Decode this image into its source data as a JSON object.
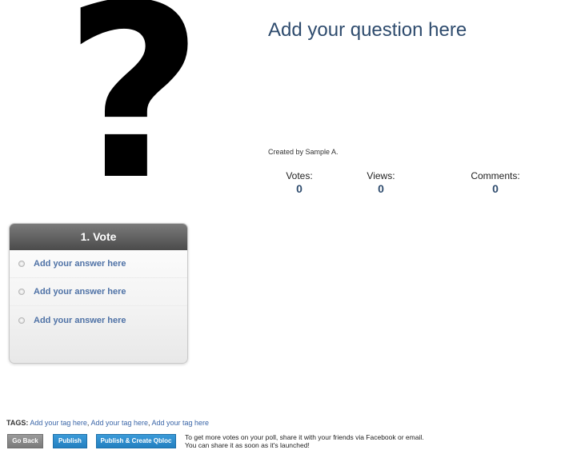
{
  "poll": {
    "question": "Add your question here",
    "created_by": "Created by Sample A.",
    "image_glyph": "?"
  },
  "stats": {
    "votes_label": "Votes:",
    "votes_value": "0",
    "views_label": "Views:",
    "views_value": "0",
    "comments_label": "Comments:",
    "comments_value": "0"
  },
  "vote_panel": {
    "header": "1. Vote",
    "answers": [
      {
        "label": "Add your answer here"
      },
      {
        "label": "Add your answer here"
      },
      {
        "label": "Add your answer here"
      }
    ]
  },
  "tags": {
    "label": "TAGS:",
    "items": [
      "Add your tag here",
      "Add your tag here",
      "Add your tag here"
    ],
    "separator": ", "
  },
  "actions": {
    "go_back": "Go Back",
    "publish": "Publish",
    "publish_create": "Publish & Create Qbloc"
  },
  "info": {
    "line1": "To get more votes on your poll, share it with your friends via Facebook or email.",
    "line2": "You can share it as soon as it's launched!"
  },
  "colors": {
    "title": "#2f4c6e",
    "link": "#3b66a8",
    "button_blue": "#2480c0",
    "button_gray": "#7a7a7a",
    "vote_header": "#4b4b4b"
  }
}
